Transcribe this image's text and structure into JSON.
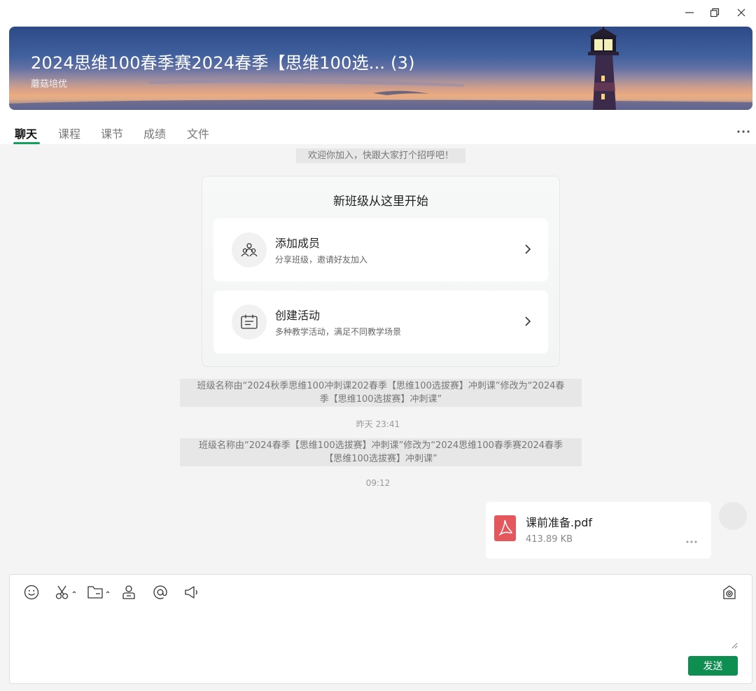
{
  "window": {
    "minimize_icon": "minimize-icon",
    "restore_icon": "restore-icon",
    "close_icon": "close-icon"
  },
  "header": {
    "title": "2024思维100春季赛2024春季【思维100选... (3)",
    "subtitle": "蘑菇培优"
  },
  "tabs": [
    {
      "label": "聊天",
      "active": true
    },
    {
      "label": "课程",
      "active": false
    },
    {
      "label": "课节",
      "active": false
    },
    {
      "label": "成绩",
      "active": false
    },
    {
      "label": "文件",
      "active": false
    }
  ],
  "chat": {
    "welcome": "欢迎你加入，快跟大家打个招呼吧！",
    "start_card": {
      "title": "新班级从这里开始",
      "actions": [
        {
          "title": "添加成员",
          "subtitle": "分享班级，邀请好友加入",
          "icon": "people-icon"
        },
        {
          "title": "创建活动",
          "subtitle": "多种教学活动，满足不同教学场景",
          "icon": "calendar-icon"
        }
      ]
    },
    "notice1_line1": "班级名称由“2024秋季思维100冲刺课202春季【思维100选拔赛】冲刺课”修改为“2024春",
    "notice1_line2": "季【思维100选拔赛】冲刺课”",
    "time1": "昨天 23:41",
    "notice2_line1": "班级名称由“2024春季【思维100选拔赛】冲刺课”修改为“2024思维100春季赛2024春季",
    "notice2_line2": "【思维100选拔赛】冲刺课”",
    "time2": "09:12",
    "file": {
      "name": "课前准备.pdf",
      "size": "413.89 KB",
      "icon": "pdf-icon"
    }
  },
  "composer": {
    "tools": [
      "emoji-icon",
      "scissors-icon",
      "folder-icon",
      "contact-icon",
      "at-icon",
      "megaphone-icon"
    ],
    "right_tool": "camera-icon",
    "input_value": "",
    "send_label": "发送"
  },
  "colors": {
    "accent": "#14a05a",
    "send": "#0f8e52",
    "pdf": "#e4575c"
  }
}
